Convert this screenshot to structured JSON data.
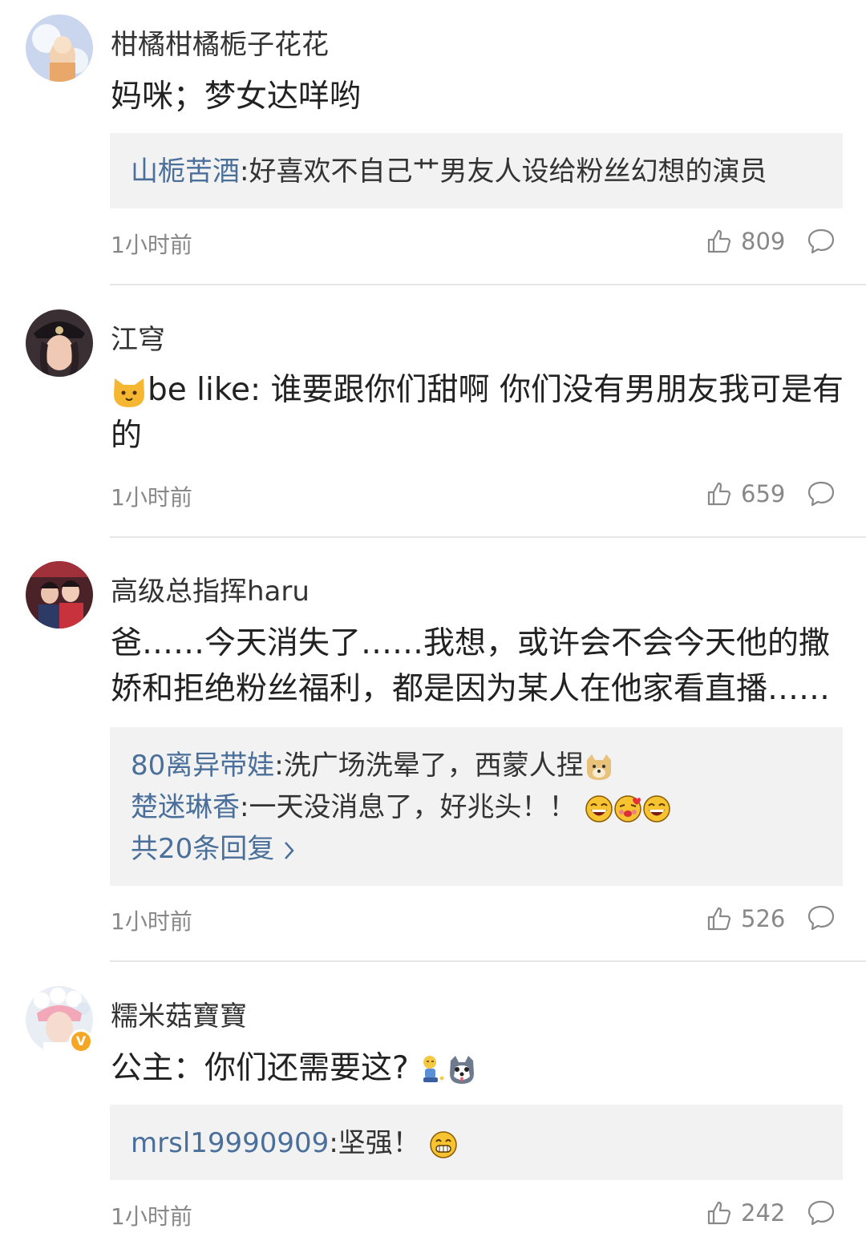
{
  "comments": [
    {
      "username": "柑橘柑橘栀子花花",
      "text": "妈咪；梦女达咩哟",
      "replies": [
        {
          "user": "山栀苦酒",
          "text": ":好喜欢不自己艹男友人设给粉丝幻想的演员"
        }
      ],
      "time": "1小时前",
      "likes": "809"
    },
    {
      "username": "江穹",
      "text": "be like: 谁要跟你们甜啊 你们没有男朋友我可是有的",
      "text_emoji": "cat-emoji",
      "time": "1小时前",
      "likes": "659"
    },
    {
      "username": "高级总指挥haru",
      "text": "爸……今天消失了……我想，或许会不会今天他的撒娇和拒绝粉丝福利，都是因为某人在他家看直播……",
      "replies": [
        {
          "user": "80离异带娃",
          "text": ":洗广场洗晕了，西蒙人捏"
        },
        {
          "user": "楚迷琳香",
          "text": ":一天没消息了，好兆头！！"
        }
      ],
      "more_replies": "共20条回复",
      "time": "1小时前",
      "likes": "526"
    },
    {
      "username": "糯米菇寶寶",
      "verified_badge": "V",
      "text": "公主：你们还需要这?",
      "replies": [
        {
          "user": "mrsl19990909",
          "text": ":坚强！"
        }
      ],
      "time": "1小时前",
      "likes": "242"
    }
  ],
  "icons": {
    "like": "thumbs-up-icon",
    "reply": "comment-bubble-icon",
    "more_chevron": "chevron-right-icon"
  },
  "colors": {
    "reply_username": "#4a6f9a",
    "reply_background": "#f2f2f2",
    "meta_gray": "#888888",
    "verified_badge": "#f5a623"
  }
}
